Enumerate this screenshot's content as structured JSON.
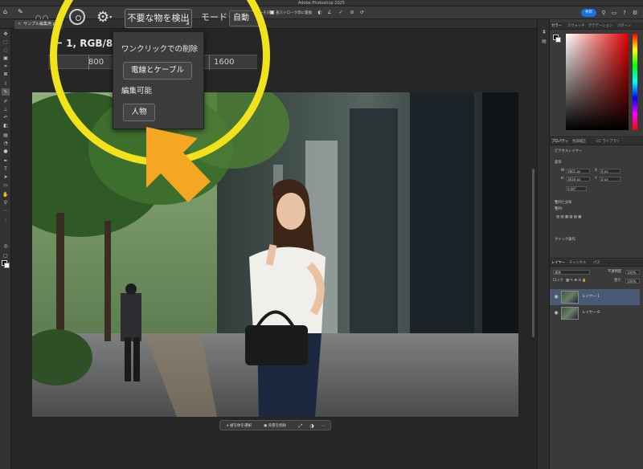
{
  "window": {
    "title": "Adobe Photoshop 2025"
  },
  "document_tab": {
    "label": "サンプル編集用.psd"
  },
  "options_bar": {
    "detect_button": "不要な物を検出",
    "mode_label": "モード",
    "mode_value": "自動",
    "stroke_overlay_label": "長ストローク等に置換",
    "sample_layers_label": "全レイヤーを対象",
    "share_label": "共有"
  },
  "zoom_callout": {
    "doc_title_fragment": "ー 1, RGB/8)",
    "ruler_ticks": [
      "800",
      "800",
      "1600"
    ]
  },
  "dropdown": {
    "one_click_heading": "ワンクリックでの削除",
    "wires_button": "電線とケーブル",
    "editable_heading": "編集可能",
    "people_button": "人物"
  },
  "contextual_taskbar": {
    "select_subject": "被写体を選択",
    "remove_background": "背景を削除"
  },
  "panels": {
    "color_tabs": [
      "カラー",
      "スウォッチ",
      "グラデーション",
      "パターン"
    ],
    "properties_tabs": [
      "プロパティ",
      "色調補正",
      "CC ライブラリ"
    ],
    "properties": {
      "layer_type": "ピクセルレイヤー",
      "transform_heading": "変形",
      "width_label": "W",
      "width_value": "5801 px",
      "height_label": "H",
      "height_value": "3634 px",
      "x_label": "X",
      "x_value": "0 px",
      "y_label": "Y",
      "y_value": "0 px",
      "angle_value": "0.00°",
      "align_heading": "整列と分布",
      "align_sub": "整列:",
      "quick_actions": "クイック操作"
    },
    "layers_tabs": [
      "レイヤー",
      "チャンネル",
      "パス"
    ],
    "layers_controls": {
      "blend_mode": "通常",
      "opacity_label": "不透明度",
      "opacity_value": "100%",
      "lock_label": "ロック",
      "fill_label": "塗り",
      "fill_value": "100%"
    },
    "layers": [
      {
        "name": "レイヤー 1",
        "selected": true
      },
      {
        "name": "レイヤー 0",
        "selected": false
      }
    ]
  },
  "colors": {
    "highlight_circle": "#f2e21b",
    "arrow": "#f5a623",
    "accent": "#1473e6"
  }
}
